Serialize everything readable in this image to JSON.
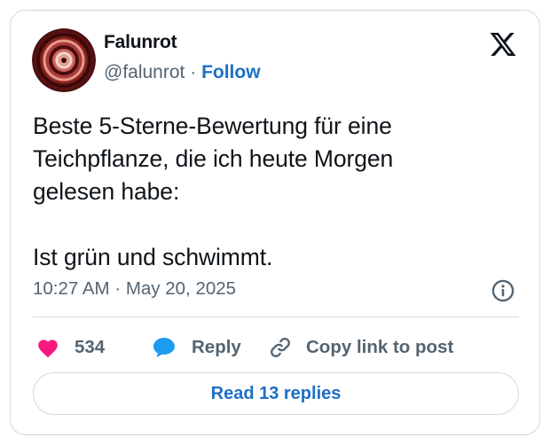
{
  "author": {
    "display_name": "Falunrot",
    "handle": "@falunrot",
    "separator": "·",
    "follow_label": "Follow"
  },
  "tweet": {
    "lines": [
      "Beste 5-Sterne-Bewertung für eine",
      "Teichpflanze, die ich heute Morgen",
      "gelesen habe:",
      "Ist grün und schwimmt."
    ],
    "timestamp": "10:27 AM · May 20, 2025"
  },
  "actions": {
    "like_count": "534",
    "reply_label": "Reply",
    "copy_label": "Copy link to post"
  },
  "footer": {
    "read_replies_label": "Read 13 replies"
  },
  "icons": {
    "brand": "x-logo-icon",
    "info": "info-icon",
    "like": "heart-icon",
    "reply": "speech-bubble-icon",
    "copy": "link-icon"
  },
  "colors": {
    "like": "#f91880",
    "reply": "#1d9bf0",
    "link": "#1d70c4",
    "muted": "#536471",
    "border": "#cfd9de"
  }
}
